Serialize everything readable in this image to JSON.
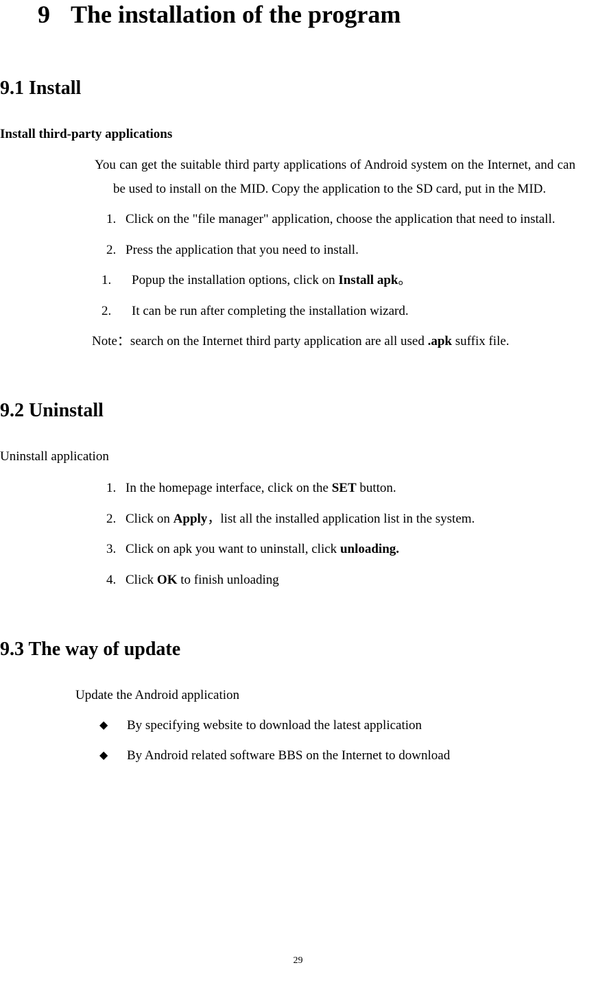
{
  "chapter": {
    "number": "9",
    "title": "The installation of the program"
  },
  "section91": {
    "heading": "9.1 Install",
    "subheading": "Install third-party applications",
    "intro": "You can get the suitable third party applications of Android system on the Internet, and can be used to install on the MID. Copy the application to the SD card, put in the MID.",
    "list1_item1_num": "1.",
    "list1_item1": "Click on the \"file manager\" application, choose the application that need to install.",
    "list1_item2_num": "2.",
    "list1_item2": "Press the application that you need to install.",
    "list2_item1_num": "1.",
    "list2_item1_pre": "Popup the installation options, click on ",
    "list2_item1_bold": "Install apk",
    "list2_item1_post": "。",
    "list2_item2_num": "2.",
    "list2_item2": "It can be run after completing the installation wizard.",
    "note_pre": "Note：search on the Internet third party application are all used ",
    "note_bold": ".apk",
    "note_post": " suffix file."
  },
  "section92": {
    "heading": "9.2 Uninstall",
    "subheading": "Uninstall application",
    "item1_num": "1.",
    "item1_pre": "In the homepage interface, click on the ",
    "item1_bold": "SET",
    "item1_post": " button.",
    "item2_num": "2.",
    "item2_pre": "Click on ",
    "item2_bold": "Apply",
    "item2_post": "，list all the installed application list in the system.",
    "item3_num": "3.",
    "item3_pre": "Click on apk you want to uninstall, click ",
    "item3_bold": "unloading.",
    "item4_num": "4.",
    "item4_pre": "Click ",
    "item4_bold": "OK",
    "item4_post": " to finish unloading"
  },
  "section93": {
    "heading": "9.3 The way of update",
    "intro": "Update the Android application",
    "bullet1": "By specifying website to download the latest application",
    "bullet2": "By Android related software BBS on the Internet to download"
  },
  "pageNumber": "29"
}
